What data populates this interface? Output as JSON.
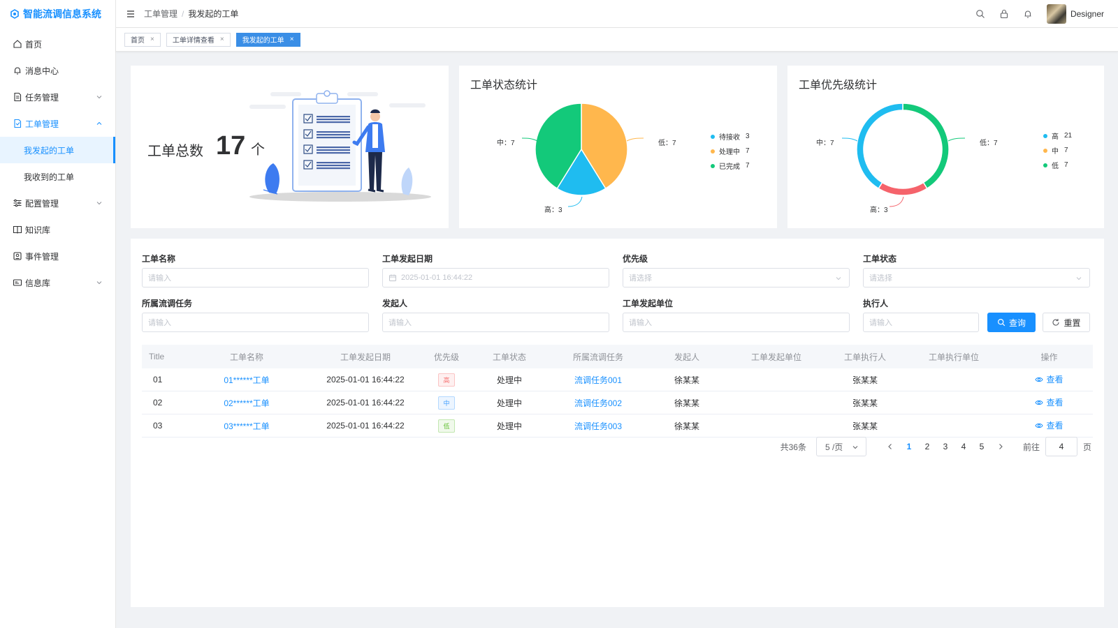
{
  "app": {
    "title": "智能流调信息系统"
  },
  "sidebar": {
    "items": [
      {
        "label": "首页"
      },
      {
        "label": "消息中心"
      },
      {
        "label": "任务管理"
      },
      {
        "label": "工单管理"
      },
      {
        "label": "我发起的工单"
      },
      {
        "label": "我收到的工单"
      },
      {
        "label": "配置管理"
      },
      {
        "label": "知识库"
      },
      {
        "label": "事件管理"
      },
      {
        "label": "信息库"
      }
    ]
  },
  "header": {
    "breadcrumb": [
      "工单管理",
      "我发起的工单"
    ],
    "user_name": "Designer"
  },
  "tags": [
    {
      "label": "首页",
      "close": "×"
    },
    {
      "label": "工单详情查看",
      "close": "×"
    },
    {
      "label": "我发起的工单",
      "close": "×"
    }
  ],
  "summary": {
    "label": "工单总数",
    "count": "17",
    "unit": "个"
  },
  "status_chart": {
    "title": "工单状态统计",
    "slice_labels": [
      "中：7",
      "低：7",
      "高：3"
    ],
    "legend": [
      {
        "name": "待接收",
        "value": "3",
        "color": "#1fbcf0"
      },
      {
        "name": "处理中",
        "value": "7",
        "color": "#ffb74d"
      },
      {
        "name": "已完成",
        "value": "7",
        "color": "#13c97a"
      }
    ]
  },
  "priority_chart": {
    "title": "工单优先级统计",
    "slice_labels": [
      "中：7",
      "低：7",
      "高：3"
    ],
    "legend": [
      {
        "name": "高",
        "value": "21",
        "color": "#1fbcf0"
      },
      {
        "name": "中",
        "value": "7",
        "color": "#ffb74d"
      },
      {
        "name": "低",
        "value": "7",
        "color": "#13c97a"
      }
    ]
  },
  "chart_data": [
    {
      "type": "pie",
      "title": "工单状态统计",
      "categories": [
        "低",
        "高",
        "中"
      ],
      "values": [
        7,
        3,
        7
      ],
      "colors": [
        "#ffb74d",
        "#1fbcf0",
        "#13c97a"
      ],
      "legend": [
        "待接收 3",
        "处理中 7",
        "已完成 7"
      ],
      "legend_position": "right"
    },
    {
      "type": "pie",
      "title": "工单优先级统计",
      "categories": [
        "低",
        "高",
        "中"
      ],
      "values": [
        7,
        3,
        7
      ],
      "colors": [
        "#13c97a",
        "#f5636b",
        "#1fbcf0"
      ],
      "donut": true,
      "legend": [
        "高 21",
        "中 7",
        "低 7"
      ],
      "legend_position": "right"
    }
  ],
  "filters": {
    "name": {
      "label": "工单名称",
      "placeholder": "请输入"
    },
    "date": {
      "label": "工单发起日期",
      "value": "2025-01-01 16:44:22"
    },
    "priority": {
      "label": "优先级",
      "placeholder": "请选择"
    },
    "status": {
      "label": "工单状态",
      "placeholder": "请选择"
    },
    "task": {
      "label": "所属流调任务",
      "placeholder": "请输入"
    },
    "initiator": {
      "label": "发起人",
      "placeholder": "请输入"
    },
    "unit": {
      "label": "工单发起单位",
      "placeholder": "请输入"
    },
    "executor": {
      "label": "执行人",
      "placeholder": "请输入"
    },
    "search_label": "查询",
    "reset_label": "重置"
  },
  "table": {
    "columns": [
      "Title",
      "工单名称",
      "工单发起日期",
      "优先级",
      "工单状态",
      "所属流调任务",
      "发起人",
      "工单发起单位",
      "工单执行人",
      "工单执行单位",
      "操作"
    ],
    "rows": [
      {
        "id": "01",
        "name": "01******工单",
        "date": "2025-01-01 16:44:22",
        "priority": "高",
        "status": "处理中",
        "task": "流调任务001",
        "initiator": "徐某某",
        "unit": "",
        "executor": "张某某",
        "exec_unit": "",
        "action": "查看"
      },
      {
        "id": "02",
        "name": "02******工单",
        "date": "2025-01-01 16:44:22",
        "priority": "中",
        "status": "处理中",
        "task": "流调任务002",
        "initiator": "徐某某",
        "unit": "",
        "executor": "张某某",
        "exec_unit": "",
        "action": "查看"
      },
      {
        "id": "03",
        "name": "03******工单",
        "date": "2025-01-01 16:44:22",
        "priority": "低",
        "status": "处理中",
        "task": "流调任务003",
        "initiator": "徐某某",
        "unit": "",
        "executor": "张某某",
        "exec_unit": "",
        "action": "查看"
      }
    ]
  },
  "priority_colors": {
    "high": "#f56c6c",
    "mid": "#409eff",
    "low": "#67c23a"
  },
  "pagination": {
    "total": "共36条",
    "page_size": "5 /页",
    "pages": [
      "1",
      "2",
      "3",
      "4",
      "5"
    ],
    "current": "1",
    "goto_label": "前往",
    "goto_value": "4",
    "page_suffix": "页"
  }
}
